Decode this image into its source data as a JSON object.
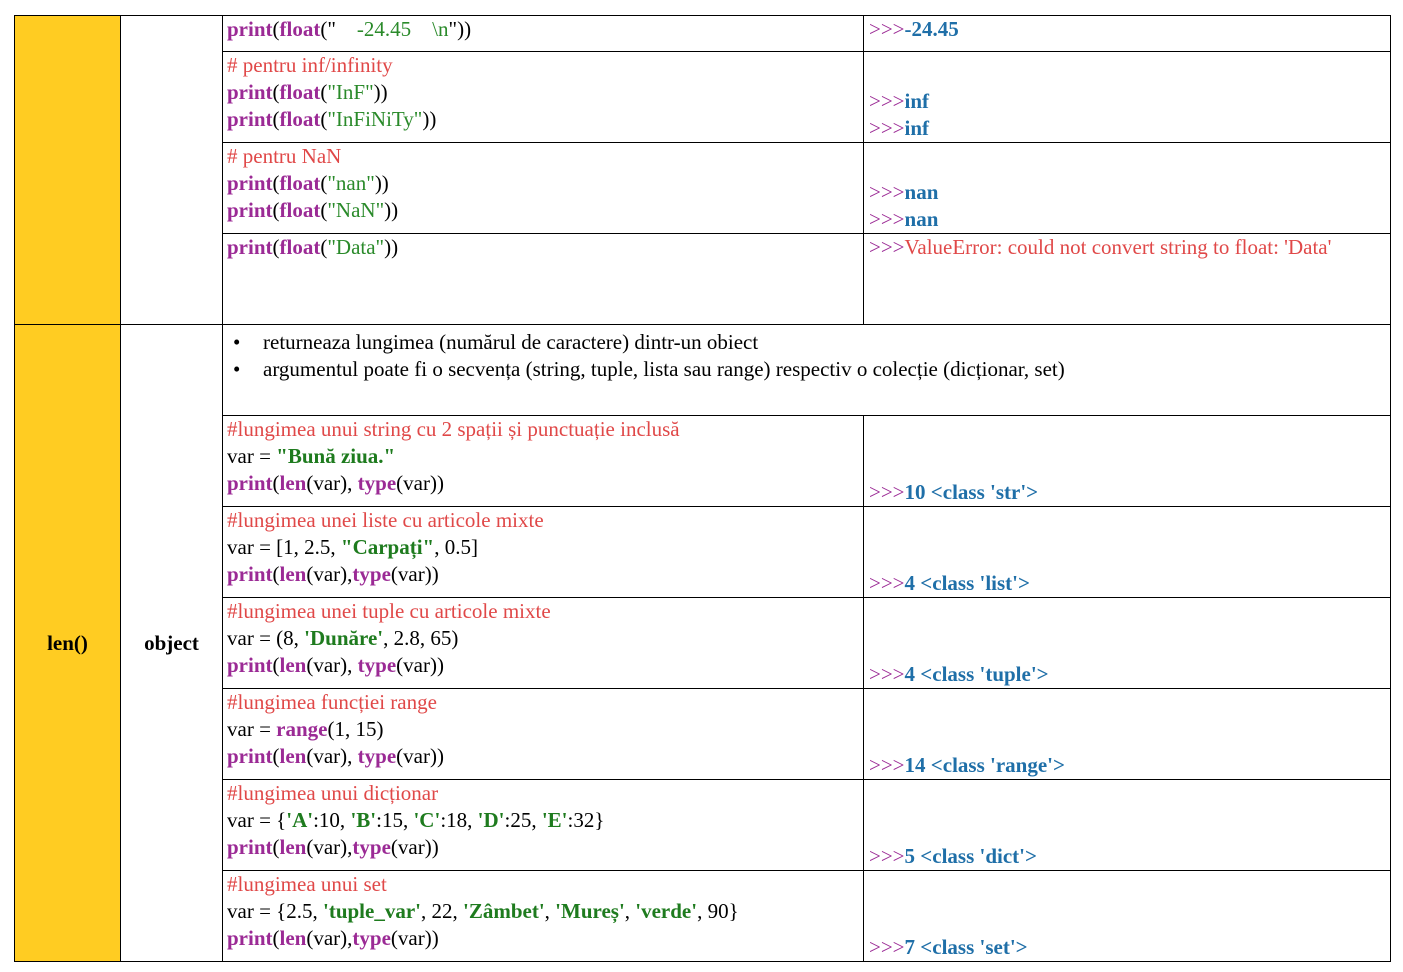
{
  "float_section": {
    "r1": {
      "code": [
        [
          "print",
          "kw"
        ],
        [
          "(",
          "p"
        ],
        [
          "float",
          "kw"
        ],
        [
          "(\"",
          "p"
        ],
        [
          "    -24.45    \\n",
          "str"
        ],
        [
          "\"))",
          "p"
        ]
      ],
      "out": [
        [
          "-24.45",
          "ov"
        ]
      ]
    },
    "r2": {
      "comment": "# pentru inf/infinity",
      "l1": [
        [
          "print",
          "kw"
        ],
        [
          "(",
          "p"
        ],
        [
          "float",
          "kw"
        ],
        [
          "(",
          "p"
        ],
        [
          "\"InF\"",
          "str"
        ],
        [
          "))",
          "p"
        ]
      ],
      "l2": [
        [
          "print",
          "kw"
        ],
        [
          "(",
          "p"
        ],
        [
          "float",
          "kw"
        ],
        [
          "(",
          "p"
        ],
        [
          "\"InFiNiTy\"",
          "str"
        ],
        [
          "))",
          "p"
        ]
      ],
      "o1": "inf",
      "o2": "inf"
    },
    "r3": {
      "comment": "# pentru NaN",
      "l1": [
        [
          "print",
          "kw"
        ],
        [
          "(",
          "p"
        ],
        [
          "float",
          "kw"
        ],
        [
          "(",
          "p"
        ],
        [
          "\"nan\"",
          "str"
        ],
        [
          "))",
          "p"
        ]
      ],
      "l2": [
        [
          "print",
          "kw"
        ],
        [
          "(",
          "p"
        ],
        [
          "float",
          "kw"
        ],
        [
          "(",
          "p"
        ],
        [
          "\"NaN\"",
          "str"
        ],
        [
          "))",
          "p"
        ]
      ],
      "o1": "nan",
      "o2": "nan"
    },
    "r4": {
      "code": [
        [
          "print",
          "kw"
        ],
        [
          "(",
          "p"
        ],
        [
          "float",
          "kw"
        ],
        [
          "(",
          "p"
        ],
        [
          "\"Data\"",
          "str"
        ],
        [
          "))",
          "p"
        ]
      ],
      "err": "ValueError: could not convert string to float: 'Data'"
    }
  },
  "prompt": ">>>",
  "len_section": {
    "name": "len()",
    "param": "object",
    "bullet1": [
      [
        "returneaza lungimea (numărul de ",
        "p"
      ],
      [
        "caractere",
        "b"
      ],
      [
        ") dintr-un ",
        "p"
      ],
      [
        "obiect",
        "b"
      ]
    ],
    "bullet2": [
      [
        "argumentul poate fi o secvența (string, tuple, lista sau range) respectiv o colecție (dicționar, set)",
        "p"
      ]
    ],
    "examples": [
      {
        "comment": "#lungimea unui string cu 2 spații și punctuație inclusă",
        "l1": [
          [
            "var = ",
            "p"
          ],
          [
            "\"Bună ziua.\"",
            "strb"
          ]
        ],
        "l2": [
          [
            "print",
            "kw"
          ],
          [
            "(",
            "p"
          ],
          [
            "len",
            "kw"
          ],
          [
            "(var), ",
            "p"
          ],
          [
            "type",
            "kw"
          ],
          [
            "(var))",
            "p"
          ]
        ],
        "out": [
          [
            "10 <class 'str'>",
            "ov"
          ]
        ]
      },
      {
        "comment": "#lungimea unei liste cu articole mixte",
        "l1": [
          [
            "var = [1, 2.5, ",
            "p"
          ],
          [
            "\"Carpați\"",
            "strb"
          ],
          [
            ", 0.5]",
            "p"
          ]
        ],
        "l2": [
          [
            "print",
            "kw"
          ],
          [
            "(",
            "p"
          ],
          [
            "len",
            "kw"
          ],
          [
            "(var),",
            "p"
          ],
          [
            "type",
            "kw"
          ],
          [
            "(var))",
            "p"
          ]
        ],
        "out": [
          [
            "4 <class 'list'>",
            "ov"
          ]
        ]
      },
      {
        "comment": "#lungimea unei tuple cu articole mixte",
        "l1": [
          [
            "var = (8, ",
            "p"
          ],
          [
            "'Dunăre'",
            "strb"
          ],
          [
            ", 2.8, 65)",
            "p"
          ]
        ],
        "l2": [
          [
            "print",
            "kw"
          ],
          [
            "(",
            "p"
          ],
          [
            "len",
            "kw"
          ],
          [
            "(var), ",
            "p"
          ],
          [
            "type",
            "kw"
          ],
          [
            "(var))",
            "p"
          ]
        ],
        "out": [
          [
            "4 <class 'tuple'>",
            "ov"
          ]
        ]
      },
      {
        "comment": "#lungimea funcției range",
        "l1": [
          [
            "var = ",
            "p"
          ],
          [
            "range",
            "kw"
          ],
          [
            "(1, 15)",
            "p"
          ]
        ],
        "l2": [
          [
            "print",
            "kw"
          ],
          [
            "(",
            "p"
          ],
          [
            "len",
            "kw"
          ],
          [
            "(var), ",
            "p"
          ],
          [
            "type",
            "kw"
          ],
          [
            "(var))",
            "p"
          ]
        ],
        "out": [
          [
            "14 <class 'range'>",
            "ov"
          ]
        ]
      },
      {
        "comment": "#lungimea unui dicționar",
        "l1": [
          [
            "var = {",
            "p"
          ],
          [
            "'A'",
            "strb"
          ],
          [
            ":10, ",
            "p"
          ],
          [
            "'B'",
            "strb"
          ],
          [
            ":15, ",
            "p"
          ],
          [
            "'C'",
            "strb"
          ],
          [
            ":18, ",
            "p"
          ],
          [
            "'D'",
            "strb"
          ],
          [
            ":25, ",
            "p"
          ],
          [
            "'E'",
            "strb"
          ],
          [
            ":32}",
            "p"
          ]
        ],
        "l2": [
          [
            "print",
            "kw"
          ],
          [
            "(",
            "p"
          ],
          [
            "len",
            "kw"
          ],
          [
            "(var),",
            "p"
          ],
          [
            "type",
            "kw"
          ],
          [
            "(var))",
            "p"
          ]
        ],
        "out": [
          [
            "5 <class 'dict'>",
            "ov"
          ]
        ]
      },
      {
        "comment": "#lungimea unui set",
        "l1": [
          [
            "var = {2.5, ",
            "p"
          ],
          [
            "'tuple_var'",
            "strb"
          ],
          [
            ", 22, ",
            "p"
          ],
          [
            "'Zâmbet'",
            "strb"
          ],
          [
            ", ",
            "p"
          ],
          [
            "'Mureș'",
            "strb"
          ],
          [
            ", ",
            "p"
          ],
          [
            "'verde'",
            "strb"
          ],
          [
            ", 90}",
            "p"
          ]
        ],
        "l2": [
          [
            "print",
            "kw"
          ],
          [
            "(",
            "p"
          ],
          [
            "len",
            "kw"
          ],
          [
            "(var),",
            "p"
          ],
          [
            "type",
            "kw"
          ],
          [
            "(var))",
            "p"
          ]
        ],
        "out": [
          [
            "7 <class 'set'>",
            "ov"
          ]
        ]
      }
    ]
  }
}
